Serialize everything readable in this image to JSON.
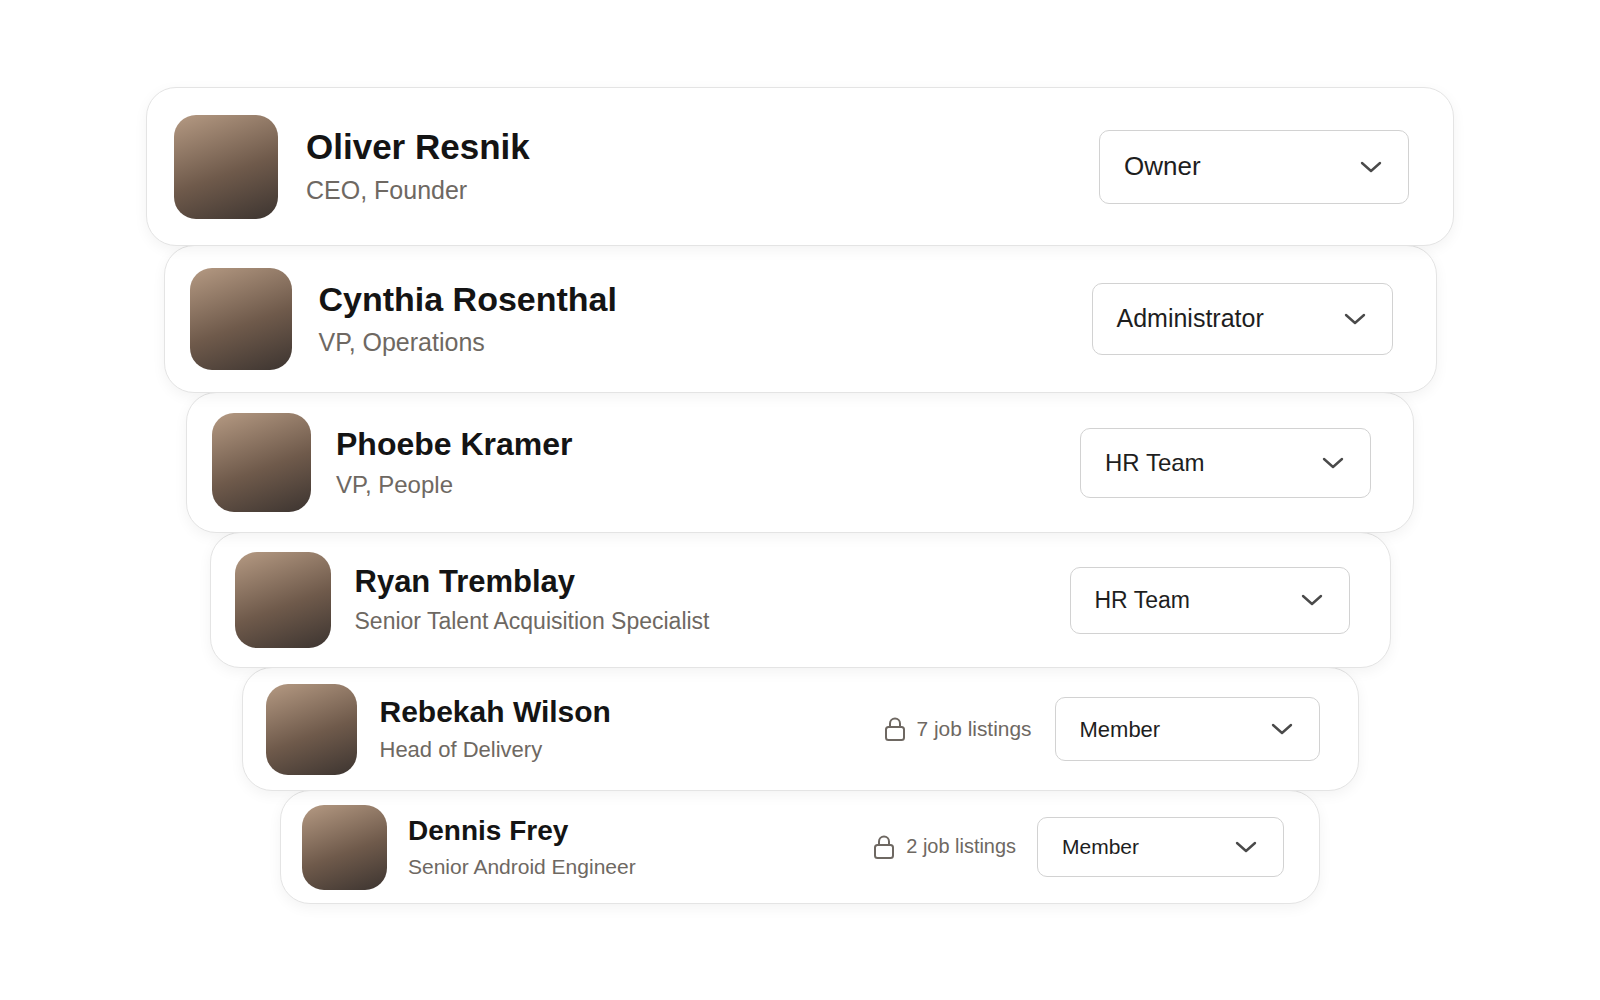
{
  "members": [
    {
      "name": "Oliver Resnik",
      "title": "CEO, Founder",
      "role": "Owner"
    },
    {
      "name": "Cynthia Rosenthal",
      "title": "VP, Operations",
      "role": "Administrator"
    },
    {
      "name": "Phoebe Kramer",
      "title": "VP, People",
      "role": "HR Team"
    },
    {
      "name": "Ryan Tremblay",
      "title": "Senior Talent Acquisition Specialist",
      "role": "HR Team"
    },
    {
      "name": "Rebekah Wilson",
      "title": "Head of Delivery",
      "job_listings": "7 job listings",
      "role": "Member"
    },
    {
      "name": "Dennis Frey",
      "title": "Senior Android Engineer",
      "job_listings": "2 job listings",
      "role": "Member"
    }
  ]
}
